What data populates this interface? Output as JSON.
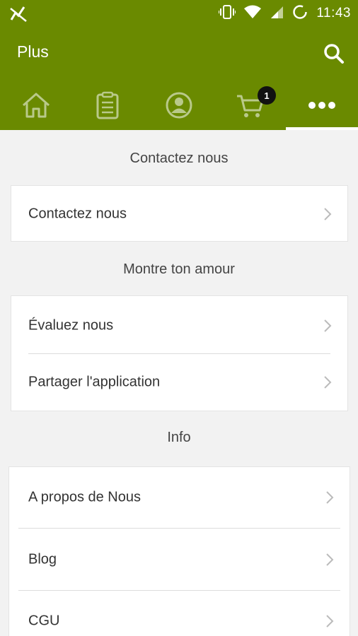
{
  "status_bar": {
    "time": "11:43"
  },
  "app_bar": {
    "title": "Plus"
  },
  "tabs": [
    {
      "icon": "home-icon"
    },
    {
      "icon": "clipboard-icon"
    },
    {
      "icon": "account-icon"
    },
    {
      "icon": "cart-icon",
      "badge": "1"
    },
    {
      "icon": "more-icon",
      "active": true
    }
  ],
  "sections": [
    {
      "title": "Contactez nous",
      "items": [
        {
          "label": "Contactez nous"
        }
      ]
    },
    {
      "title": "Montre ton amour",
      "items": [
        {
          "label": "Évaluez nous"
        },
        {
          "label": "Partager l'application"
        }
      ]
    },
    {
      "title": "Info",
      "items": [
        {
          "label": "A propos de Nous"
        },
        {
          "label": "Blog"
        },
        {
          "label": "CGU"
        }
      ]
    }
  ],
  "colors": {
    "brand": "#6a8a00",
    "background": "#f2f2f2",
    "card": "#ffffff"
  }
}
